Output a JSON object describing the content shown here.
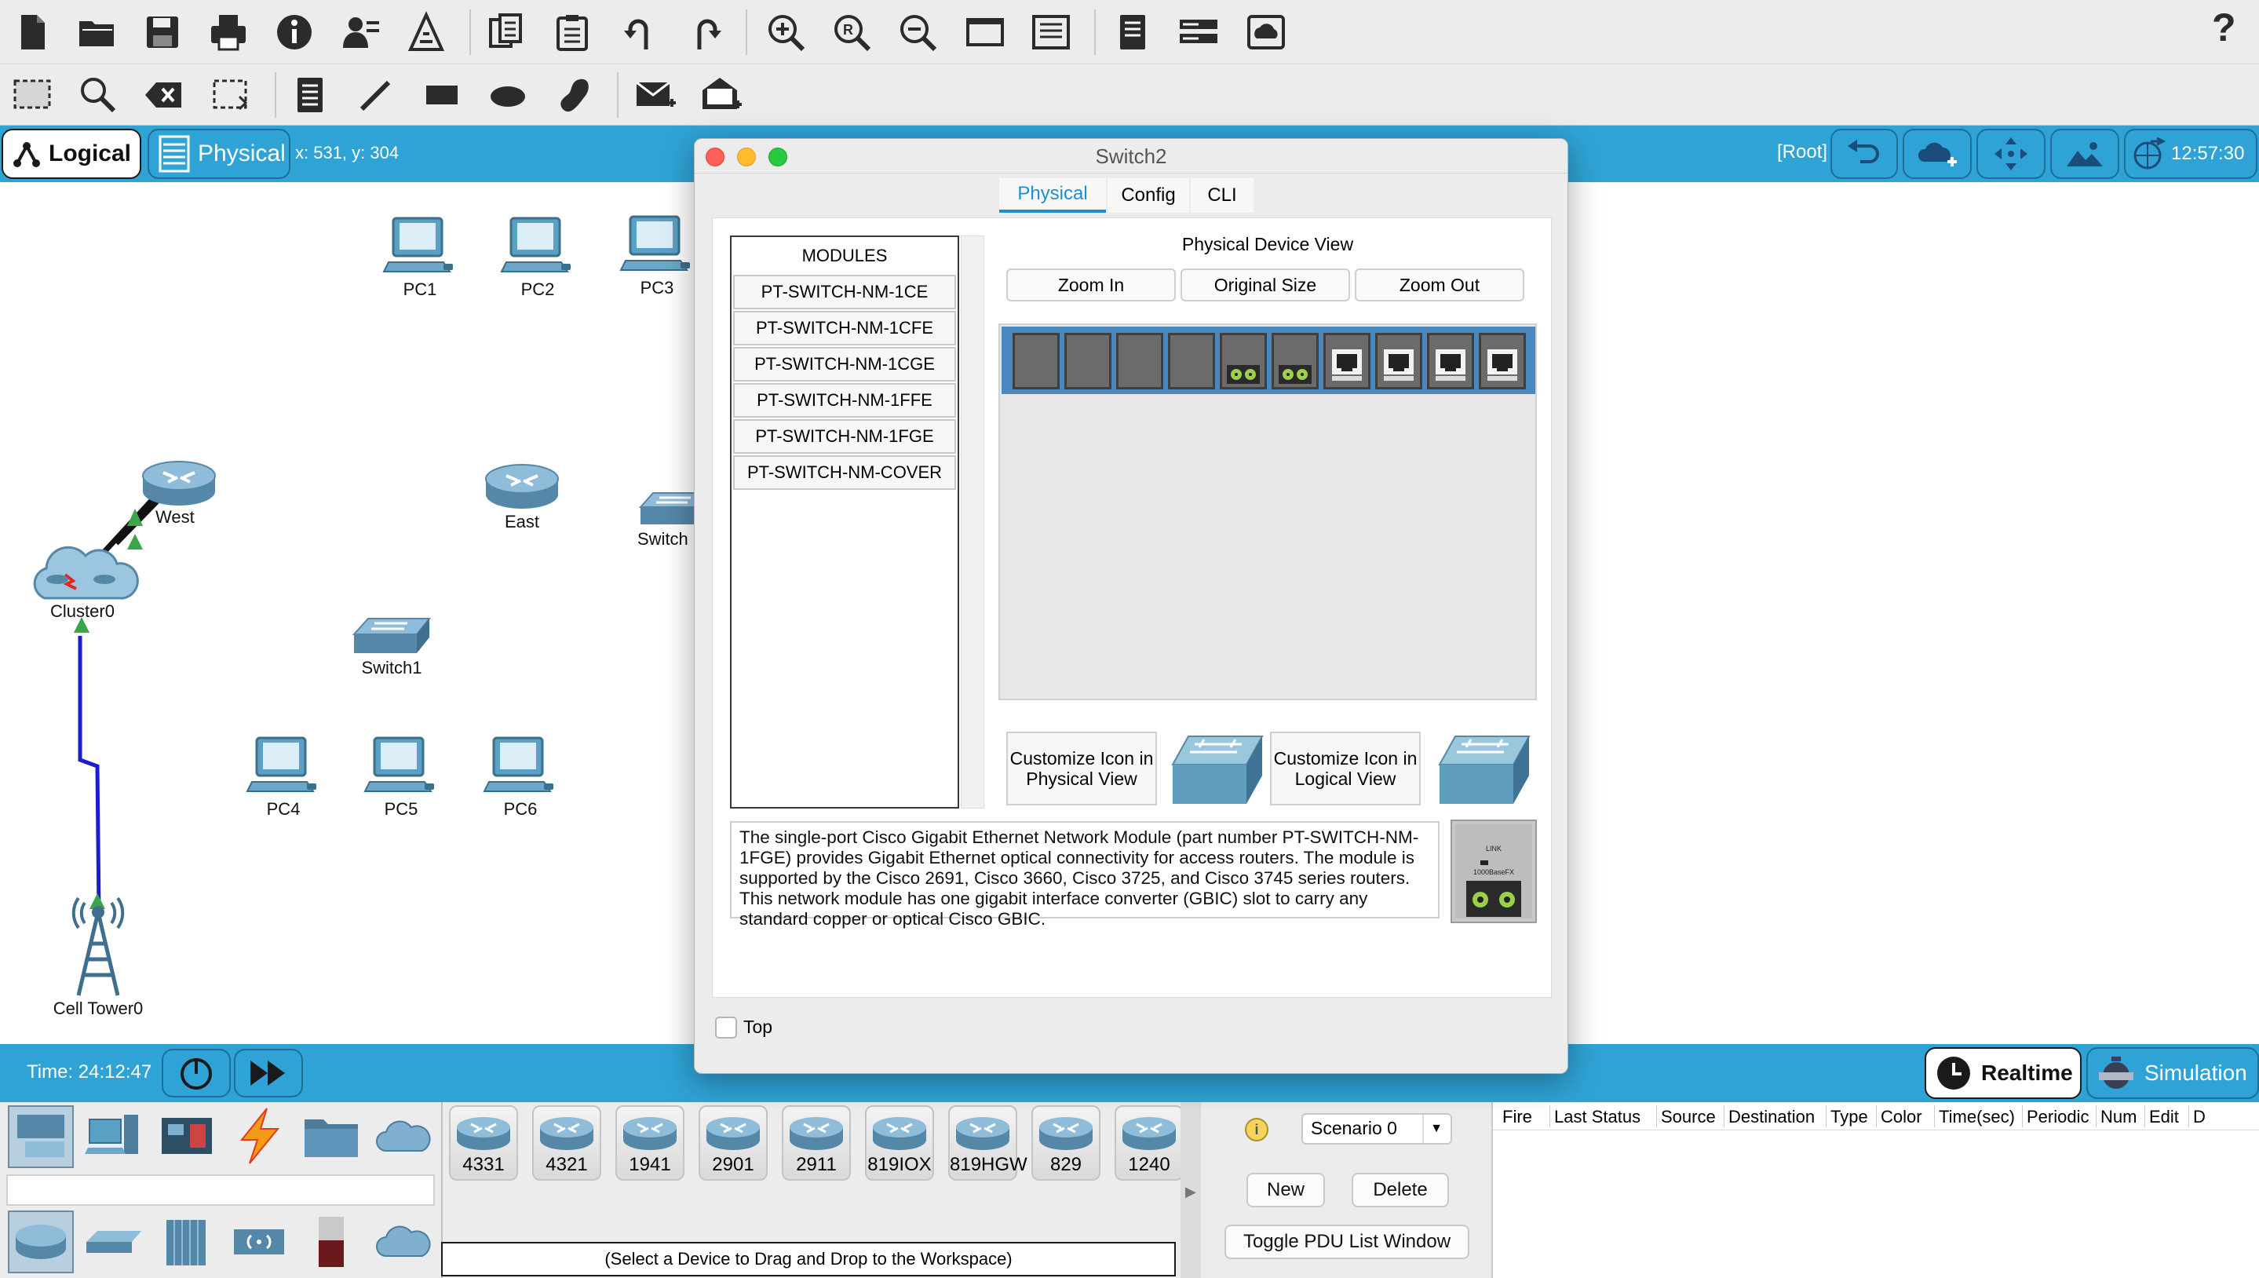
{
  "toolbar": {
    "help_label": "?"
  },
  "modebar": {
    "logical_label": "Logical",
    "physical_label": "Physical",
    "coords": "x: 531, y: 304",
    "root_label": "[Root]",
    "clock": "12:57:30"
  },
  "devices": {
    "pc1": "PC1",
    "pc2": "PC2",
    "pc3": "PC3",
    "west": "West",
    "east": "East",
    "switch_partial": "Switch",
    "cluster0": "Cluster0",
    "switch1": "Switch1",
    "pc4": "PC4",
    "pc5": "PC5",
    "pc6": "PC6",
    "celltower0": "Cell Tower0"
  },
  "timebar": {
    "time": "Time: 24:12:47",
    "realtime_label": "Realtime",
    "simulation_label": "Simulation"
  },
  "dialog": {
    "title": "Switch2",
    "tabs": [
      "Physical",
      "Config",
      "CLI"
    ],
    "modules_header": "MODULES",
    "modules": [
      "PT-SWITCH-NM-1CE",
      "PT-SWITCH-NM-1CFE",
      "PT-SWITCH-NM-1CGE",
      "PT-SWITCH-NM-1FFE",
      "PT-SWITCH-NM-1FGE",
      "PT-SWITCH-NM-COVER"
    ],
    "device_view_title": "Physical Device View",
    "zoom_in": "Zoom In",
    "original_size": "Original Size",
    "zoom_out": "Zoom Out",
    "customize_physical": "Customize Icon in Physical View",
    "customize_logical": "Customize Icon in Logical View",
    "description": "The single-port Cisco Gigabit Ethernet Network Module (part number PT-SWITCH-NM-1FGE) provides Gigabit Ethernet optical connectivity for access routers. The module is supported by the Cisco 2691, Cisco 3660, Cisco 3725, and Cisco 3745 series routers. This network module has one gigabit interface converter (GBIC) slot to carry any standard copper or optical Cisco GBIC.",
    "module_image_label": "1000BaseFX",
    "module_image_sublabel": "LINK",
    "top_label": "Top"
  },
  "bottom": {
    "router_models": [
      "4331",
      "4321",
      "1941",
      "2901",
      "2911",
      "819IOX",
      "819HGW",
      "829",
      "1240"
    ],
    "hint": "(Select a Device to Drag and Drop to the Workspace)",
    "scenario": "Scenario 0",
    "new_label": "New",
    "delete_label": "Delete",
    "toggle_pdu": "Toggle PDU List Window",
    "pdu_columns": [
      "Fire",
      "Last Status",
      "Source",
      "Destination",
      "Type",
      "Color",
      "Time(sec)",
      "Periodic",
      "Num",
      "Edit",
      "D"
    ]
  },
  "colors": {
    "accent_blue": "#2fa3d6",
    "chassis_blue": "#4a88c0",
    "tab_active": "#1d8fd0"
  }
}
